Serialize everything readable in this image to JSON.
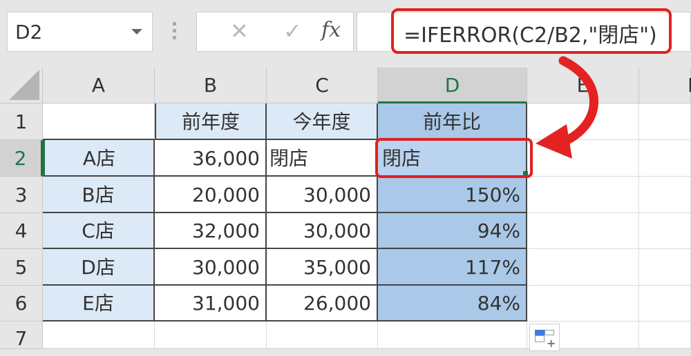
{
  "name_box": {
    "value": "D2"
  },
  "formula_bar": {
    "cancel_icon": "✕",
    "enter_icon": "✓",
    "fx_label": "fx",
    "formula": "=IFERROR(C2/B2,\"閉店\")"
  },
  "columns": [
    "A",
    "B",
    "C",
    "D",
    "E",
    "F"
  ],
  "rows": [
    "1",
    "2",
    "3",
    "4",
    "5",
    "6",
    "7"
  ],
  "selected_cell": "D2",
  "table": {
    "headers": [
      "",
      "前年度",
      "今年度",
      "前年比"
    ],
    "data": [
      [
        "A店",
        "36,000",
        "閉店",
        "閉店"
      ],
      [
        "B店",
        "20,000",
        "30,000",
        "150%"
      ],
      [
        "C店",
        "32,000",
        "30,000",
        "94%"
      ],
      [
        "D店",
        "30,000",
        "35,000",
        "117%"
      ],
      [
        "E店",
        "31,000",
        "26,000",
        "84%"
      ]
    ]
  },
  "annotation": {
    "highlight_color": "#e02020"
  },
  "accent_color": "#217346"
}
